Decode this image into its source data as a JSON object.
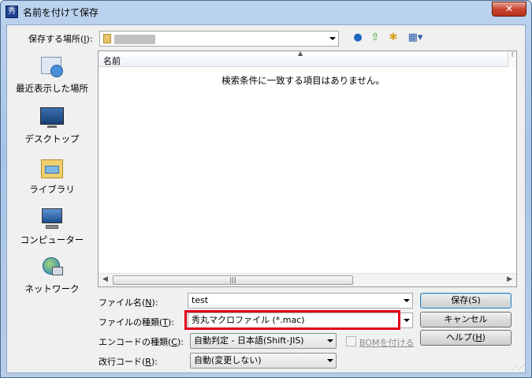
{
  "window": {
    "title": "名前を付けて保存",
    "close_symbol": "✕"
  },
  "location": {
    "label": "保存する場所",
    "hotkey": "I",
    "label_suffix": "):"
  },
  "places": [
    {
      "label": "最近表示した場所",
      "icon": "recent-places-icon"
    },
    {
      "label": "デスクトップ",
      "icon": "desktop-icon"
    },
    {
      "label": "ライブラリ",
      "icon": "libraries-icon"
    },
    {
      "label": "コンピューター",
      "icon": "computer-icon"
    },
    {
      "label": "ネットワーク",
      "icon": "network-icon"
    }
  ],
  "file_list": {
    "column_name": "名前",
    "empty_message": "検索条件に一致する項目はありません。"
  },
  "filename": {
    "label": "ファイル名(",
    "hotkey": "N",
    "suffix": "):",
    "value": "test"
  },
  "filetype": {
    "label": "ファイルの種類(",
    "hotkey": "T",
    "suffix": "):",
    "value": "秀丸マクロファイル (*.mac)"
  },
  "encoding": {
    "label": "エンコードの種類(",
    "hotkey": "C",
    "suffix": "):",
    "value": "自動判定 - 日本語(Shift-JIS)"
  },
  "bom": {
    "label": "BOMを付ける",
    "hotkey": "O",
    "checked": false
  },
  "linebreak": {
    "label": "改行コード(",
    "hotkey": "R",
    "suffix": "):",
    "value": "自動(変更しない)"
  },
  "buttons": {
    "save": "保存(S)",
    "cancel": "キャンセル",
    "help_prefix": "ヘルプ(",
    "help_hotkey": "H",
    "help_suffix": ")"
  },
  "colors": {
    "highlight": "#e0001b",
    "title_bar": "#bcd3ee",
    "close_button": "#c7462f"
  }
}
